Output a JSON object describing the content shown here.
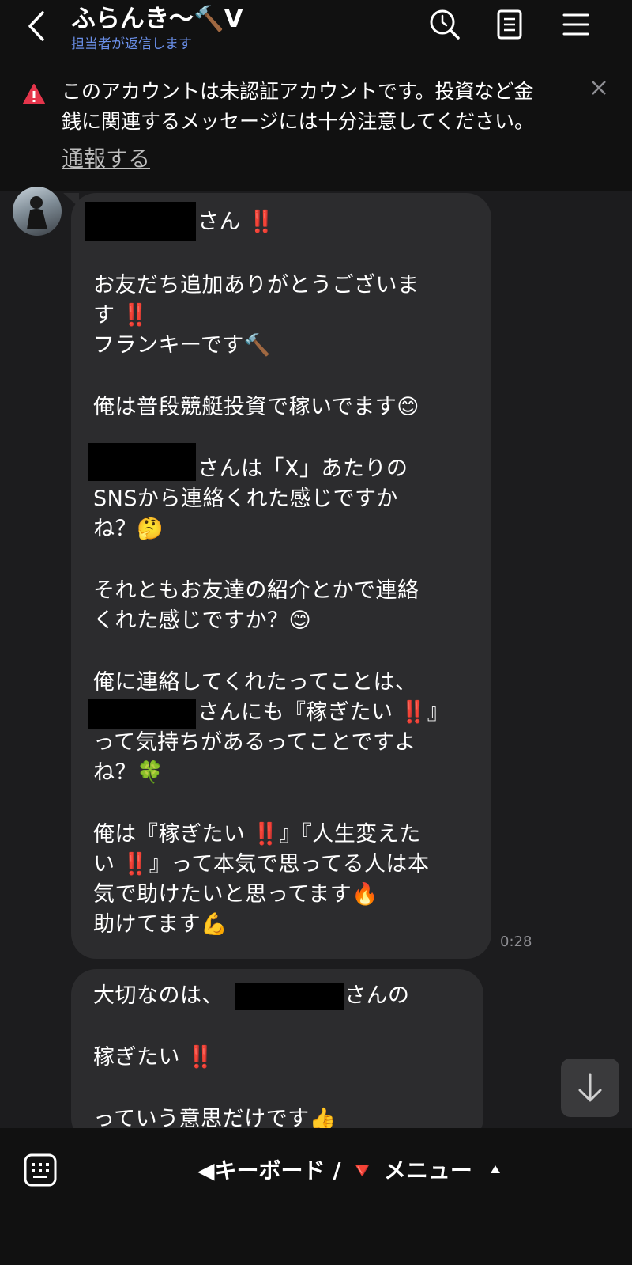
{
  "header": {
    "title": "ふらんき〜🔨V",
    "subtitle": "担当者が返信します"
  },
  "banner": {
    "lines": [
      "このアカウントは未認証アカウントです。投資など金",
      "銭に関連するメッセージには十分注意してください。"
    ],
    "report_label": "通報する"
  },
  "messages": [
    {
      "time": "0:28",
      "lines": [
        "さん ‼️",
        "お友だち追加ありがとうございま",
        "す ‼️",
        "フランキーです🔨",
        "俺は普段競艇投資で稼いでます😊",
        "さんは「X」あたりの",
        "SNSから連絡くれた感じですか",
        "ね？🤔",
        "それともお友達の紹介とかで連絡",
        "くれた感じですか？😊",
        "俺に連絡してくれたってことは、",
        "さんにも『稼ぎたい ‼️』",
        "って気持ちがあるってことですよ",
        "ね？🍀",
        "俺は『稼ぎたい ‼️』『人生変えた",
        "い ‼️』って本気で思ってる人は本",
        "気で助けたいと思ってます🔥",
        "助けてます💪"
      ]
    },
    {
      "lines": [
        "大切なのは、",
        "さんの",
        "稼ぎたい ‼️",
        "っていう意思だけです👍"
      ]
    }
  ],
  "bottom_bar": {
    "menu_label": "◀キーボード / 🔻 メニュー"
  },
  "icons": {
    "back": "chevron-left-icon",
    "search": "search-clock-icon",
    "notes": "notes-icon",
    "menu": "hamburger-icon",
    "warning": "warning-triangle-icon",
    "close": "close-icon",
    "scroll": "arrow-down-icon",
    "keyboard": "keyboard-icon"
  },
  "colors": {
    "background": "#1c1c1e",
    "bar": "#111111",
    "bubble": "#2c2c2e",
    "subtitle": "#6a8fe8",
    "warning": "#e5354b"
  }
}
